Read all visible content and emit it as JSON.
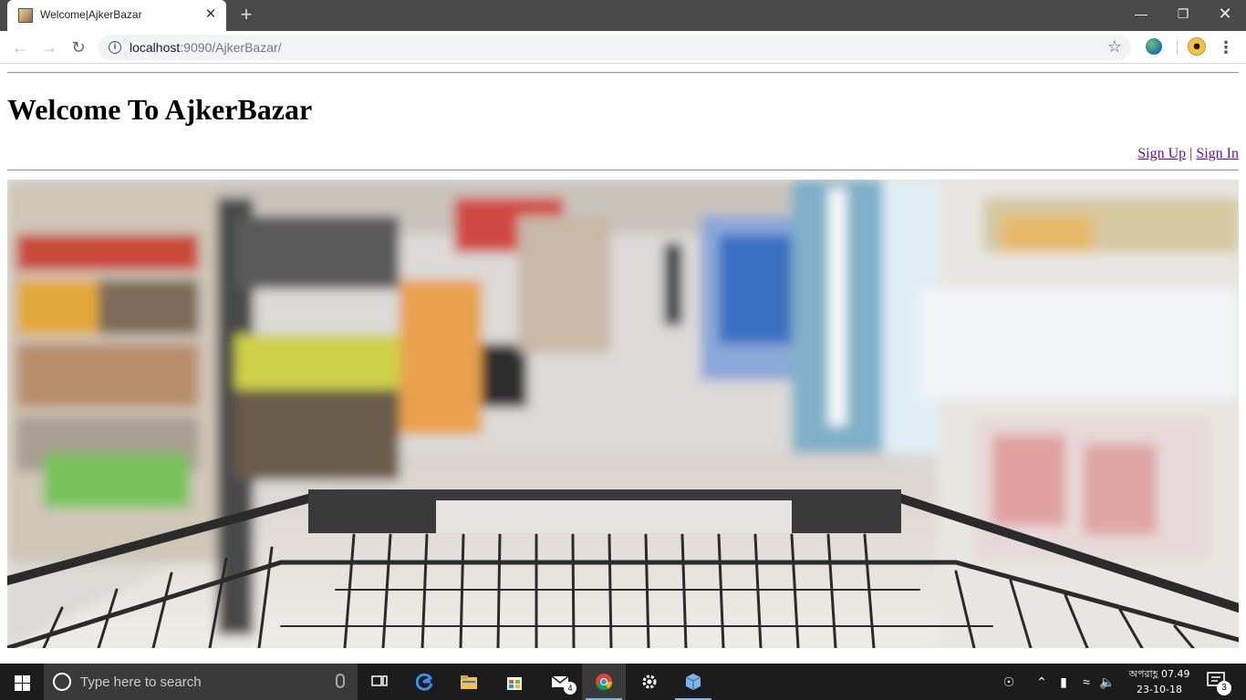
{
  "browser": {
    "tab_title": "Welcome|AjkerBazar",
    "url_host": "localhost",
    "url_rest": ":9090/AjkerBazar/",
    "new_tab_icon": "+",
    "close_icon": "✕"
  },
  "page": {
    "heading": "Welcome To AjkerBazar",
    "links": {
      "sign_up": "Sign Up",
      "separator": "|",
      "sign_in": "Sign In"
    },
    "link_color": "#551a8b",
    "hero_image": "blurred supermarket aisle with shopping cart"
  },
  "taskbar": {
    "search_placeholder": "Type here to search",
    "mail_badge": "4",
    "clock_time": "অপরাহ্ণ 07.49",
    "clock_date": "23-10-18",
    "notification_count": "3",
    "apps": [
      "task-view",
      "edge",
      "file-explorer",
      "store",
      "mail",
      "chrome",
      "settings",
      "app"
    ]
  }
}
